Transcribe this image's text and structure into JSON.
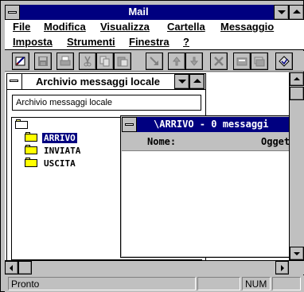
{
  "app": {
    "title": "Mail"
  },
  "menu": {
    "row1": [
      "File",
      "Modifica",
      "Visualizza",
      "Cartella",
      "Messaggio"
    ],
    "row2": [
      "Imposta",
      "Strumenti",
      "Finestra",
      "?"
    ]
  },
  "toolbar": {
    "icons": [
      "compose-icon",
      "save-icon",
      "print-icon",
      "cut-icon",
      "copy-icon",
      "paste-icon",
      "move-icon",
      "previous-icon",
      "next-icon",
      "delete-icon",
      "open-folder-icon",
      "folders-icon",
      "properties-icon"
    ]
  },
  "folder_window": {
    "title": "Archivio messaggi locale",
    "path": "Archivio messaggi locale",
    "folders": [
      "ARRIVO",
      "INVIATA",
      "USCITA"
    ],
    "selected": "ARRIVO"
  },
  "message_window": {
    "title": "\\ARRIVO -   0 messaggi",
    "columns": [
      "Nome:",
      "Oggetto:"
    ]
  },
  "status": {
    "text": "Pronto",
    "num": "NUM"
  },
  "colors": {
    "title_active": "#000080",
    "face": "#c0c0c0",
    "folder": "#ffff00"
  }
}
